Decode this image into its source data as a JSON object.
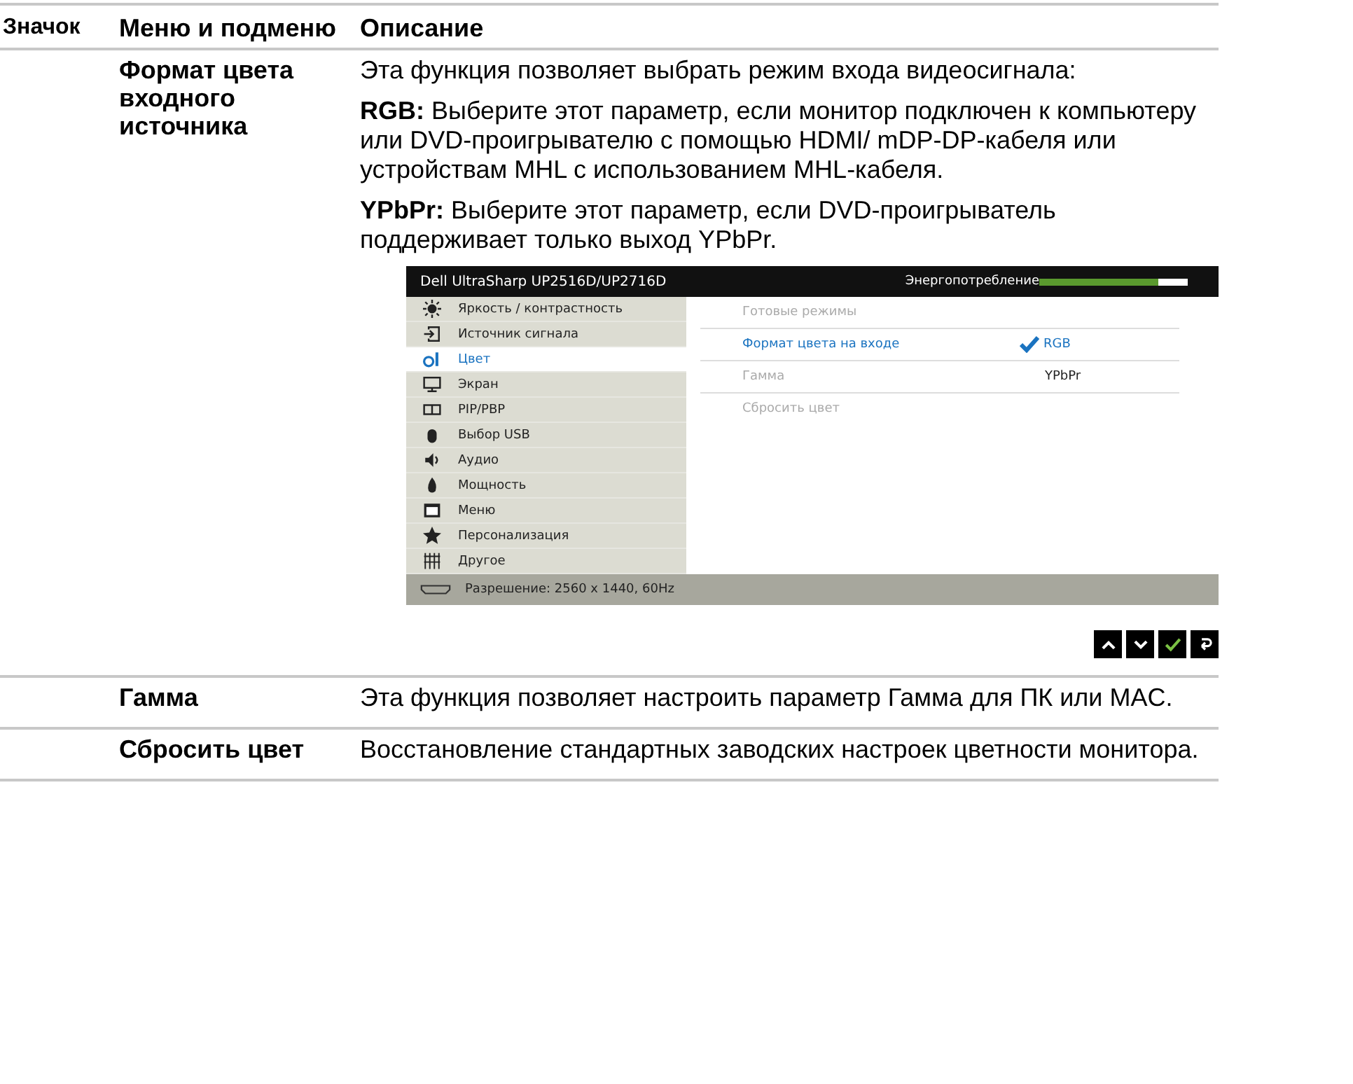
{
  "table": {
    "columns": [
      "Значок",
      "Меню и подменю",
      "Описание"
    ],
    "rows": [
      {
        "menu": "Формат цвета входного источника",
        "paragraphs": [
          "Эта функция позволяет выбрать режим входа видеосигнала:",
          "**RGB:** Выберите этот параметр, если монитор подключен к компьютеру или DVD-проигрывателю с помощью HDMI/ mDP-DP-кабеля или устройствам MHL с использованием MHL-кабеля.",
          "**YPbPr:** Выберите этот параметр, если DVD-проигрыватель поддерживает только выход YPbPr."
        ],
        "osd": {
          "title": "Dell UltraSharp UP2516D/UP2716D",
          "power_label": "Энергопотребление",
          "power": {
            "level": 0.8
          },
          "menu": [
            {
              "label": "Яркость / контрастность",
              "selected": false
            },
            {
              "label": "Источник сигнала",
              "selected": false
            },
            {
              "label": "Цвет",
              "selected": true
            },
            {
              "label": "Экран",
              "selected": false
            },
            {
              "label": "PIP/PBP",
              "selected": false
            },
            {
              "label": "Выбор USB",
              "selected": false
            },
            {
              "label": "Аудио",
              "selected": false
            },
            {
              "label": "Мощность",
              "selected": false
            },
            {
              "label": "Меню",
              "selected": false
            },
            {
              "label": "Персонализация",
              "selected": false
            },
            {
              "label": "Другое",
              "selected": false
            }
          ],
          "submenu": [
            {
              "label": "Готовые режимы",
              "selected": false
            },
            {
              "label": "Формат цвета на входе",
              "selected": true
            },
            {
              "label": "Гамма",
              "selected": false
            },
            {
              "label": "Сбросить цвет",
              "selected": false
            }
          ],
          "options": [
            {
              "label": "RGB",
              "checked": true
            },
            {
              "label": "YPbPr",
              "checked": false
            }
          ],
          "status": "Разрешение: 2560 x 1440, 60Hz"
        }
      },
      {
        "menu": "Гамма",
        "paragraphs": [
          "Эта функция позволяет настроить параметр Гамма для ПК или MAC."
        ]
      },
      {
        "menu": "Сбросить цвет",
        "paragraphs": [
          "Восстановление стандартных заводских настроек цветности монитора."
        ]
      }
    ]
  }
}
